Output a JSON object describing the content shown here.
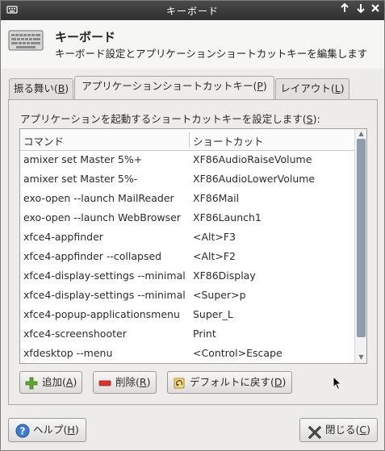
{
  "window": {
    "title": "キーボード"
  },
  "header": {
    "title": "キーボード",
    "subtitle": "キーボード設定とアプリケーションショートカットキーを編集します"
  },
  "tabs": [
    {
      "label": "振る舞い",
      "mnemonic": "B"
    },
    {
      "label": "アプリケーションショートカットキー",
      "mnemonic": "P"
    },
    {
      "label": "レイアウト",
      "mnemonic": "L"
    }
  ],
  "description": {
    "text": "アプリケーションを起動するショートカットキーを設定します",
    "mnemonic": "S"
  },
  "table": {
    "headers": {
      "command": "コマンド",
      "shortcut": "ショートカット"
    },
    "rows": [
      {
        "command": "amixer set Master 5%+",
        "shortcut": "XF86AudioRaiseVolume"
      },
      {
        "command": "amixer set Master 5%-",
        "shortcut": "XF86AudioLowerVolume"
      },
      {
        "command": "exo-open --launch MailReader",
        "shortcut": "XF86Mail"
      },
      {
        "command": "exo-open --launch WebBrowser",
        "shortcut": "XF86Launch1"
      },
      {
        "command": "xfce4-appfinder",
        "shortcut": "<Alt>F3"
      },
      {
        "command": "xfce4-appfinder --collapsed",
        "shortcut": "<Alt>F2"
      },
      {
        "command": "xfce4-display-settings --minimal",
        "shortcut": "XF86Display"
      },
      {
        "command": "xfce4-display-settings --minimal",
        "shortcut": "<Super>p"
      },
      {
        "command": "xfce4-popup-applicationsmenu",
        "shortcut": "Super_L"
      },
      {
        "command": "xfce4-screenshooter",
        "shortcut": "Print"
      },
      {
        "command": "xfdesktop --menu",
        "shortcut": "<Control>Escape"
      }
    ]
  },
  "buttons": {
    "add": {
      "label": "追加",
      "mnemonic": "A"
    },
    "remove": {
      "label": "削除",
      "mnemonic": "R"
    },
    "reset": {
      "label": "デフォルトに戻す",
      "mnemonic": "D"
    },
    "help": {
      "label": "ヘルプ",
      "mnemonic": "H"
    },
    "close": {
      "label": "閉じる",
      "mnemonic": "C"
    }
  },
  "colors": {
    "titlebar": "#3a3a3a",
    "scroll_thumb": "#8e9cab",
    "add_icon": "#5aa832",
    "remove_icon": "#d9342b",
    "help_icon": "#3b7bd1",
    "close_icon": "#444444"
  }
}
